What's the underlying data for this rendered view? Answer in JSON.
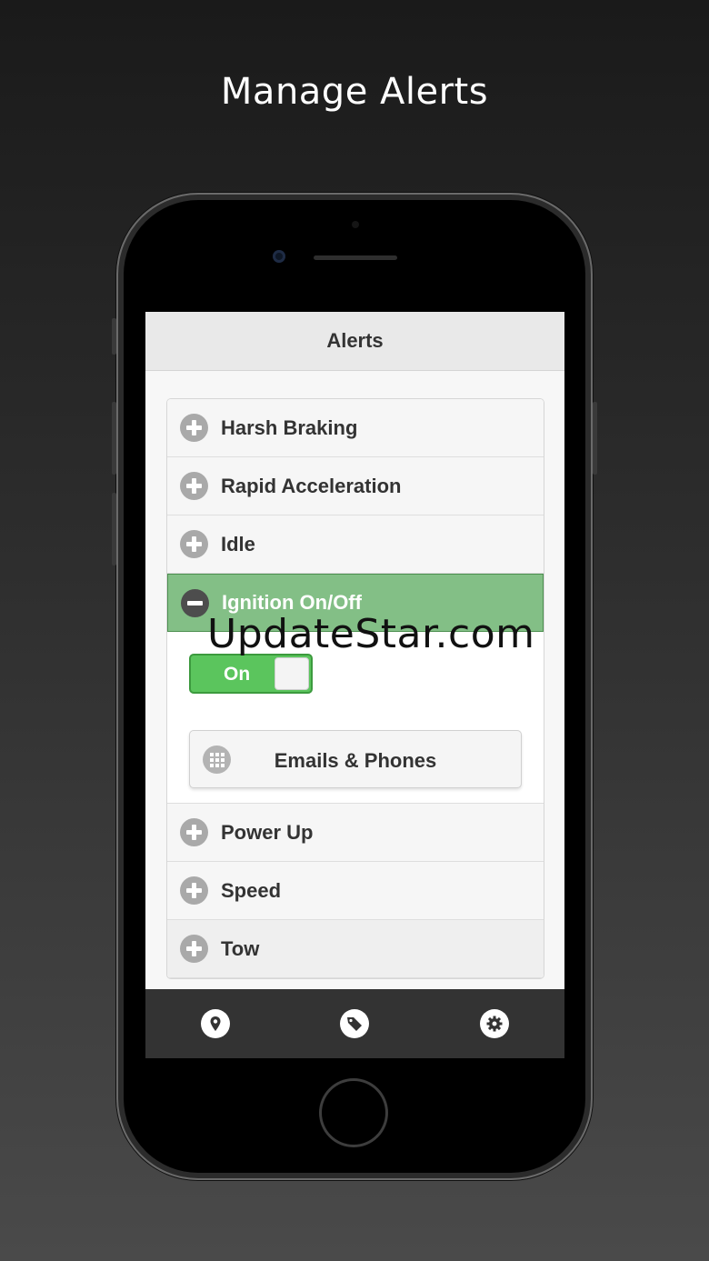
{
  "headline": "Manage Alerts",
  "app": {
    "title": "Alerts"
  },
  "alerts": {
    "items": [
      {
        "label": "Harsh Braking"
      },
      {
        "label": "Rapid Acceleration"
      },
      {
        "label": "Idle"
      },
      {
        "label": "Ignition On/Off"
      },
      {
        "label": "Power Up"
      },
      {
        "label": "Speed"
      },
      {
        "label": "Tow"
      }
    ],
    "expanded": {
      "toggle_label": "On",
      "toggle_on": true,
      "emails_button": "Emails & Phones"
    }
  },
  "tabbar": {
    "icons": [
      "location-pin-icon",
      "tag-icon",
      "gear-icon"
    ]
  },
  "watermark": "UpdateStar.com",
  "colors": {
    "active_row": "#83bf86",
    "toggle_on": "#5bc55d",
    "tabbar": "#333333"
  }
}
